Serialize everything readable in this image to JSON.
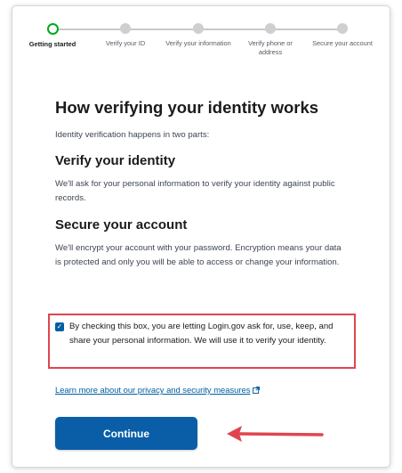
{
  "steps": [
    {
      "label": "Getting started",
      "current": true
    },
    {
      "label": "Verify your ID",
      "current": false
    },
    {
      "label": "Verify your information",
      "current": false
    },
    {
      "label": "Verify phone or address",
      "current": false
    },
    {
      "label": "Secure your account",
      "current": false
    }
  ],
  "page": {
    "title": "How verifying your identity works",
    "intro": "Identity verification happens in two parts:"
  },
  "sections": {
    "verify": {
      "heading": "Verify your identity",
      "body": "We'll ask for your personal information to verify your identity against public records."
    },
    "secure": {
      "heading": "Secure your account",
      "body": "We'll encrypt your account with your password. Encryption means your data is protected and only you will be able to access or change your information."
    }
  },
  "consent": {
    "checked": true,
    "text": "By checking this box, you are letting Login.gov ask for, use, keep, and share your personal information. We will use it to verify your identity."
  },
  "learn_more": {
    "label": "Learn more about our privacy and security measures",
    "icon": "external-link-icon"
  },
  "continue": {
    "label": "Continue"
  },
  "colors": {
    "primary": "#0a5ea8",
    "link": "#005ea2",
    "step_current": "#00a91c",
    "highlight": "#e0454f"
  }
}
